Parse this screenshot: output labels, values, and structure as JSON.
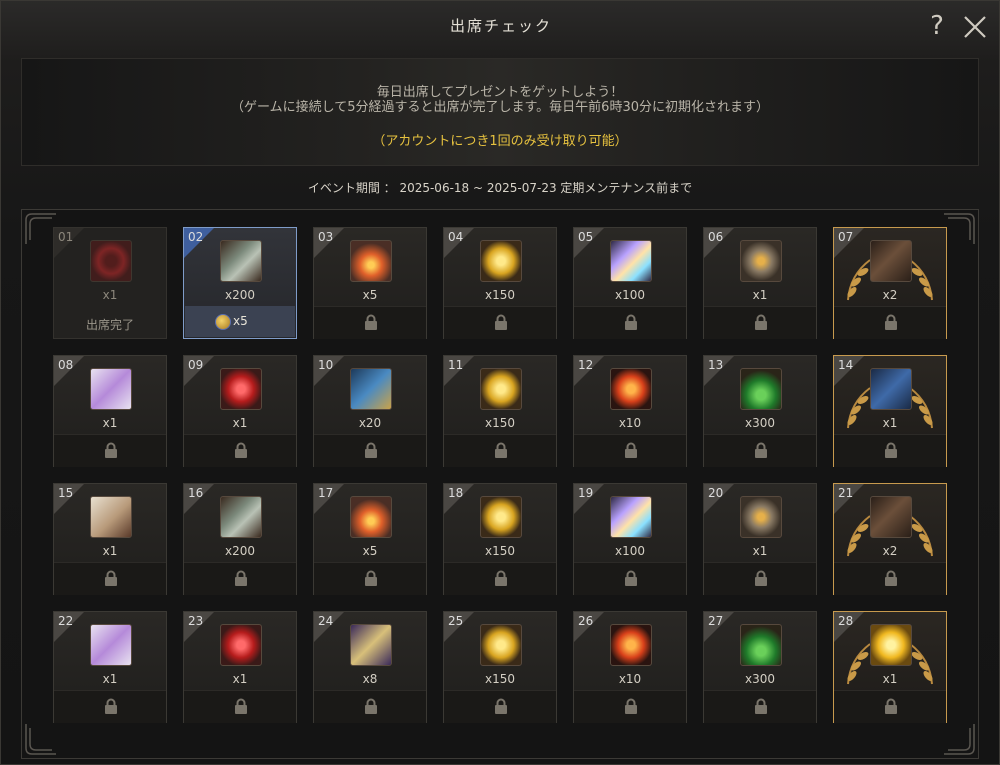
{
  "window": {
    "title": "出席チェック"
  },
  "info": {
    "line1": "毎日出席してプレゼントをゲットしよう！",
    "line2": "（ゲームに接続して5分経過すると出席が完了します。毎日午前6時30分に初期化されます）",
    "line3": "（アカウントにつき1回のみ受け取り可能）"
  },
  "period": "イベント期間 ： 2025-06-18 ~ 2025-07-23 定期メンテナンス前まで",
  "days": [
    {
      "day": "01",
      "icon": "red-wreath-icon",
      "qty": "x1",
      "status": "出席完了",
      "state": "done"
    },
    {
      "day": "02",
      "icon": "scroll-icon",
      "qty": "x200",
      "bonus_qty": "x5",
      "state": "today"
    },
    {
      "day": "03",
      "icon": "fire-stone-icon",
      "qty": "x5",
      "state": "locked"
    },
    {
      "day": "04",
      "icon": "gold-coin-icon",
      "qty": "x150",
      "state": "locked"
    },
    {
      "day": "05",
      "icon": "crystal-shard-icon",
      "qty": "x100",
      "state": "locked"
    },
    {
      "day": "06",
      "icon": "heart-medal-icon",
      "qty": "x1",
      "state": "locked"
    },
    {
      "day": "07",
      "icon": "card-pack-icon",
      "qty": "x2",
      "state": "locked",
      "special": true
    },
    {
      "day": "08",
      "icon": "gift-box-icon",
      "qty": "x1",
      "state": "locked"
    },
    {
      "day": "09",
      "icon": "red-heart-icon",
      "qty": "x1",
      "state": "locked"
    },
    {
      "day": "10",
      "icon": "map-scroll-icon",
      "qty": "x20",
      "state": "locked"
    },
    {
      "day": "11",
      "icon": "gold-coin-icon",
      "qty": "x150",
      "state": "locked"
    },
    {
      "day": "12",
      "icon": "fire-orb-icon",
      "qty": "x10",
      "state": "locked"
    },
    {
      "day": "13",
      "icon": "green-potion-icon",
      "qty": "x300",
      "state": "locked"
    },
    {
      "day": "14",
      "icon": "blue-card-icon",
      "qty": "x1",
      "state": "locked",
      "special": true
    },
    {
      "day": "15",
      "icon": "ticket-icon",
      "qty": "x1",
      "state": "locked"
    },
    {
      "day": "16",
      "icon": "scroll-icon",
      "qty": "x200",
      "state": "locked"
    },
    {
      "day": "17",
      "icon": "fire-stone-icon",
      "qty": "x5",
      "state": "locked"
    },
    {
      "day": "18",
      "icon": "gold-coin-icon",
      "qty": "x150",
      "state": "locked"
    },
    {
      "day": "19",
      "icon": "crystal-shard-icon",
      "qty": "x100",
      "state": "locked"
    },
    {
      "day": "20",
      "icon": "heart-medal-icon",
      "qty": "x1",
      "state": "locked"
    },
    {
      "day": "21",
      "icon": "card-pack-icon",
      "qty": "x2",
      "state": "locked",
      "special": true
    },
    {
      "day": "22",
      "icon": "gift-box-icon",
      "qty": "x1",
      "state": "locked"
    },
    {
      "day": "23",
      "icon": "red-heart-icon",
      "qty": "x1",
      "state": "locked"
    },
    {
      "day": "24",
      "icon": "rune-stone-icon",
      "qty": "x8",
      "state": "locked"
    },
    {
      "day": "25",
      "icon": "gold-coin-icon",
      "qty": "x150",
      "state": "locked"
    },
    {
      "day": "26",
      "icon": "fire-orb-icon",
      "qty": "x10",
      "state": "locked"
    },
    {
      "day": "27",
      "icon": "green-potion-icon",
      "qty": "x300",
      "state": "locked"
    },
    {
      "day": "28",
      "icon": "golden-orb-icon",
      "qty": "x1",
      "state": "locked",
      "special": true
    }
  ],
  "colors": {
    "accent_gold": "#e7c23f",
    "special_border": "#c79a4e",
    "today_border": "#7f9cc9"
  }
}
